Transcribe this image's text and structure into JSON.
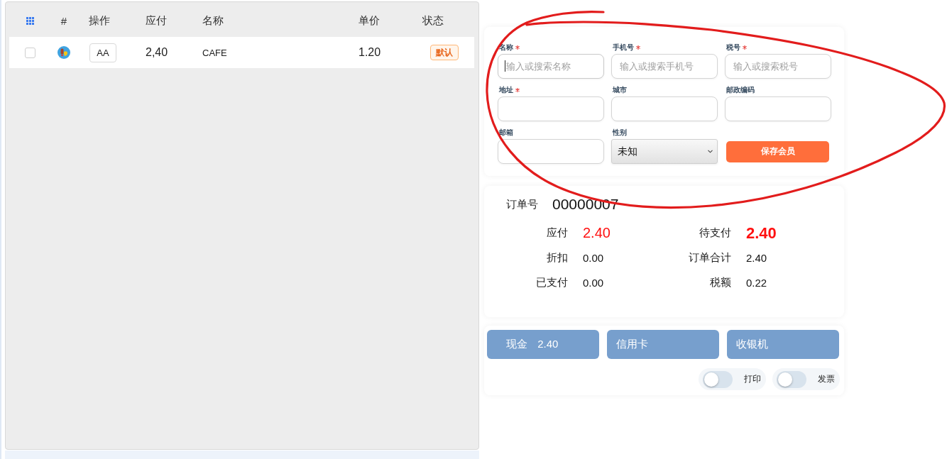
{
  "table": {
    "columns": [
      "#",
      "操作",
      "应付",
      "名称",
      "单价",
      "状态"
    ],
    "rows": [
      {
        "checked": false,
        "action": "AA",
        "payable": "2,40",
        "name": "CAFE",
        "price": "1.20",
        "status": "默认"
      }
    ]
  },
  "member_form": {
    "fields": [
      {
        "label": "名称",
        "required": true,
        "kind": "text",
        "placeholder": "输入或搜索名称",
        "focused": true
      },
      {
        "label": "手机号",
        "required": true,
        "kind": "text",
        "placeholder": "输入或搜索手机号",
        "focused": false
      },
      {
        "label": "税号",
        "required": true,
        "kind": "text",
        "placeholder": "输入或搜索税号",
        "focused": false
      },
      {
        "label": "地址",
        "required": true,
        "kind": "text",
        "focused": false
      },
      {
        "label": "城市",
        "required": false,
        "kind": "text",
        "focused": false
      },
      {
        "label": "邮政编码",
        "required": false,
        "kind": "text",
        "focused": false
      },
      {
        "label": "邮箱",
        "required": false,
        "kind": "text",
        "focused": false
      },
      {
        "label": "性别",
        "required": false,
        "kind": "select",
        "value": "未知"
      }
    ],
    "save_button": "保存会员"
  },
  "order": {
    "number_label": "订单号",
    "number": "00000007",
    "summary": [
      {
        "label": "应付",
        "value": "2.40",
        "kind": "due"
      },
      {
        "label": "待支付",
        "value": "2.40",
        "kind": "outstanding"
      },
      {
        "label": "折扣",
        "value": "0.00",
        "kind": "plain"
      },
      {
        "label": "订单合计",
        "value": "2.40",
        "kind": "plain"
      },
      {
        "label": "已支付",
        "value": "0.00",
        "kind": "plain"
      },
      {
        "label": "税额",
        "value": "0.22",
        "kind": "plain"
      }
    ]
  },
  "payment": {
    "methods": [
      {
        "label": "现金",
        "amount": "2.40"
      },
      {
        "label": "信用卡"
      },
      {
        "label": "收银机"
      }
    ],
    "toggles": [
      {
        "label": "打印",
        "on": false
      },
      {
        "label": "发票",
        "on": false
      }
    ]
  }
}
